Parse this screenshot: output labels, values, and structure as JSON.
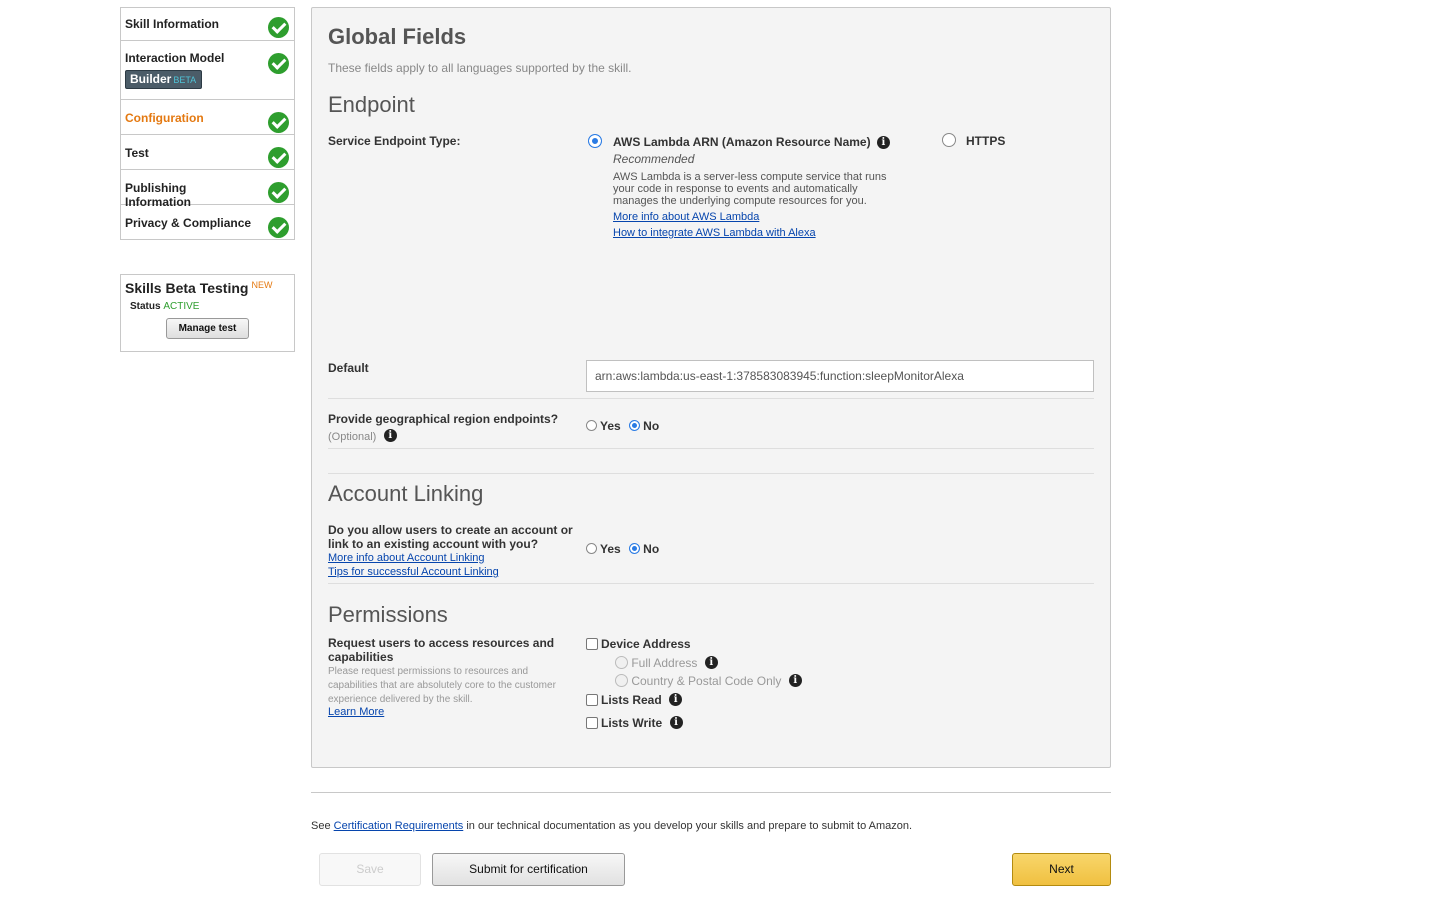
{
  "sidebar": {
    "items": [
      {
        "label": "Skill Information"
      },
      {
        "label": "Interaction Model",
        "badge": "Builder",
        "badge_tag": "BETA"
      },
      {
        "label": "Configuration"
      },
      {
        "label": "Test"
      },
      {
        "label": "Publishing Information"
      },
      {
        "label": "Privacy & Compliance"
      }
    ],
    "beta_testing": {
      "title": "Skills Beta Testing",
      "new_tag": "NEW",
      "status_label": "Status",
      "status_value": "ACTIVE",
      "manage_button": "Manage test"
    }
  },
  "main": {
    "title": "Global Fields",
    "subtitle": "These fields apply to all languages supported by the skill.",
    "endpoint": {
      "heading": "Endpoint",
      "type_label": "Service Endpoint Type:",
      "lambda_option": "AWS Lambda ARN (Amazon Resource Name)",
      "recommended": "Recommended",
      "lambda_description": "AWS Lambda is a server-less compute service that runs your code in response to events and automatically manages the underlying compute resources for you.",
      "link_more_info": "More info about AWS Lambda",
      "link_integrate": "How to integrate AWS Lambda with Alexa",
      "https_option": "HTTPS",
      "default_label": "Default",
      "default_value": "arn:aws:lambda:us-east-1:378583083945:function:sleepMonitorAlexa",
      "geo_label": "Provide geographical region endpoints?",
      "geo_optional": "(Optional)",
      "yes": "Yes",
      "no": "No"
    },
    "account_linking": {
      "heading": "Account Linking",
      "question": "Do you allow users to create an account or link to an existing account with you?",
      "link_more_info": "More info about Account Linking",
      "link_tips": "Tips for successful Account Linking",
      "yes": "Yes",
      "no": "No"
    },
    "permissions": {
      "heading": "Permissions",
      "label": "Request users to access resources and capabilities",
      "description": "Please request permissions to resources and capabilities that are absolutely core to the customer experience delivered by the skill.",
      "learn_more": "Learn More",
      "device_address": "Device Address",
      "full_address": "Full Address",
      "country_postal": "Country & Postal Code Only",
      "lists_read": "Lists Read",
      "lists_write": "Lists Write"
    }
  },
  "footer": {
    "see": "See",
    "cert_link": "Certification Requirements",
    "cert_text": "in our technical documentation as you develop your skills and prepare to submit to Amazon.",
    "save": "Save",
    "submit": "Submit for certification",
    "next": "Next"
  },
  "colors": {
    "active_nav": "#e47911",
    "check_green": "#2e9e2e",
    "radio_blue": "#2a7be4",
    "next_button": "#f0c040"
  }
}
